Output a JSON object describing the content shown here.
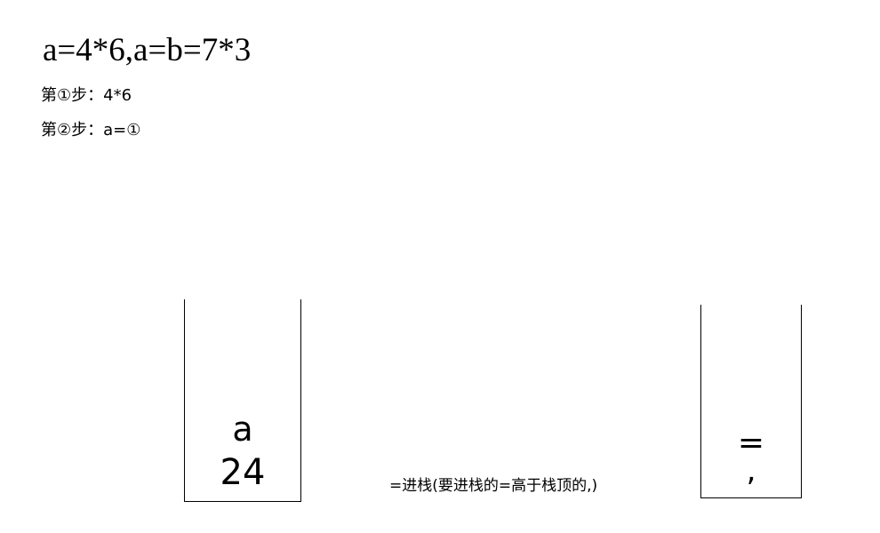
{
  "expression": "a=4*6,a=b=7*3",
  "steps": [
    {
      "label": "第①步：4*6"
    },
    {
      "label": "第②步：a=①"
    }
  ],
  "operand_stack": {
    "items": [
      "a",
      "24"
    ]
  },
  "operator_stack": {
    "items": [
      "=",
      ","
    ]
  },
  "note": "=进栈(要进栈的=高于栈顶的,)"
}
